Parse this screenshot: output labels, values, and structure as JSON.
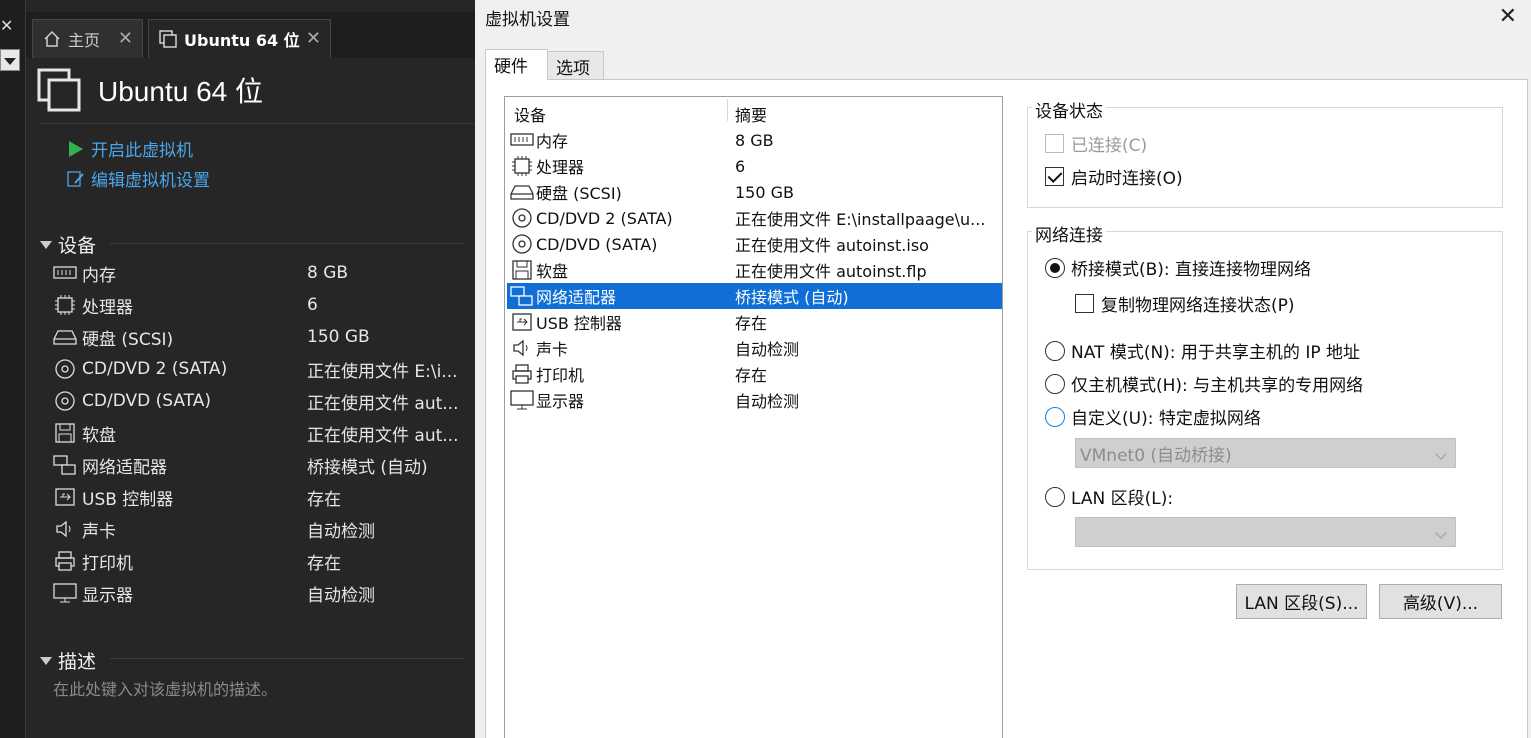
{
  "left": {
    "tabs": [
      {
        "label": "主页"
      },
      {
        "label": "Ubuntu 64 位"
      }
    ],
    "vm_title": "Ubuntu 64 位",
    "actions": {
      "start": "开启此虚拟机",
      "edit": "编辑虚拟机设置"
    },
    "devices_section": "设备",
    "devices": [
      {
        "icon": "memory-icon",
        "name": "内存",
        "value": "8 GB"
      },
      {
        "icon": "processor-icon",
        "name": "处理器",
        "value": "6"
      },
      {
        "icon": "harddisk-icon",
        "name": "硬盘 (SCSI)",
        "value": "150 GB"
      },
      {
        "icon": "cdrom-icon",
        "name": "CD/DVD 2 (SATA)",
        "value": "正在使用文件 E:\\i..."
      },
      {
        "icon": "cdrom-icon",
        "name": "CD/DVD (SATA)",
        "value": "正在使用文件 aut..."
      },
      {
        "icon": "floppy-icon",
        "name": "软盘",
        "value": "正在使用文件 aut..."
      },
      {
        "icon": "network-adapter-icon",
        "name": "网络适配器",
        "value": "桥接模式 (自动)"
      },
      {
        "icon": "usb-icon",
        "name": "USB 控制器",
        "value": "存在"
      },
      {
        "icon": "sound-icon",
        "name": "声卡",
        "value": "自动检测"
      },
      {
        "icon": "printer-icon",
        "name": "打印机",
        "value": "存在"
      },
      {
        "icon": "display-icon",
        "name": "显示器",
        "value": "自动检测"
      }
    ],
    "description_section": "描述",
    "description_placeholder": "在此处键入对该虚拟机的描述。"
  },
  "dialog": {
    "title": "虚拟机设置",
    "tabs": {
      "hardware": "硬件",
      "options": "选项"
    },
    "list": {
      "col_device": "设备",
      "col_summary": "摘要",
      "rows": [
        {
          "icon": "memory-icon",
          "name": "内存",
          "value": "8 GB"
        },
        {
          "icon": "processor-icon",
          "name": "处理器",
          "value": "6"
        },
        {
          "icon": "harddisk-icon",
          "name": "硬盘 (SCSI)",
          "value": "150 GB"
        },
        {
          "icon": "cdrom-icon",
          "name": "CD/DVD 2 (SATA)",
          "value": "正在使用文件 E:\\installpaage\\u..."
        },
        {
          "icon": "cdrom-icon",
          "name": "CD/DVD (SATA)",
          "value": "正在使用文件 autoinst.iso"
        },
        {
          "icon": "floppy-icon",
          "name": "软盘",
          "value": "正在使用文件 autoinst.flp"
        },
        {
          "icon": "network-adapter-icon",
          "name": "网络适配器",
          "value": "桥接模式 (自动)"
        },
        {
          "icon": "usb-icon",
          "name": "USB 控制器",
          "value": "存在"
        },
        {
          "icon": "sound-icon",
          "name": "声卡",
          "value": "自动检测"
        },
        {
          "icon": "printer-icon",
          "name": "打印机",
          "value": "存在"
        },
        {
          "icon": "display-icon",
          "name": "显示器",
          "value": "自动检测"
        }
      ],
      "selected": "网络适配器"
    },
    "device_status": {
      "title": "设备状态",
      "connected": "已连接(C)",
      "connected_checked": false,
      "connect_on_power": "启动时连接(O)",
      "connect_on_power_checked": true
    },
    "network": {
      "title": "网络连接",
      "bridged": "桥接模式(B): 直接连接物理网络",
      "replicate": "复制物理网络连接状态(P)",
      "nat": "NAT 模式(N): 用于共享主机的 IP 地址",
      "hostonly": "仅主机模式(H): 与主机共享的专用网络",
      "custom": "自定义(U): 特定虚拟网络",
      "custom_select": "VMnet0 (自动桥接)",
      "lan": "LAN 区段(L):",
      "lan_select": "",
      "selected_mode": "bridged"
    },
    "buttons": {
      "lan_segments": "LAN 区段(S)...",
      "advanced": "高级(V)..."
    }
  },
  "colors": {
    "accent_link": "#4aa6e8",
    "selection": "#0f6fd6",
    "start_green": "#2fb34a"
  }
}
